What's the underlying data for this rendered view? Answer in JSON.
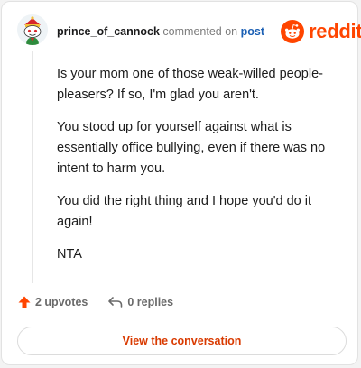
{
  "comment": {
    "username": "prince_of_cannock",
    "action_text": "commented on",
    "target_link": "post",
    "paragraphs": [
      "Is your mom one of those weak-willed people-pleasers? If so, I'm glad you aren't.",
      "You stood up for yourself against what is essentially office bullying, even if there was no intent to harm you.",
      "You did the right thing and I hope you'd do it again!",
      "NTA"
    ]
  },
  "brand": {
    "name": "reddit",
    "color": "#ff4500",
    "icon": "reddit-snoo-icon"
  },
  "actions": {
    "upvotes_label": "2 upvotes",
    "upvote_icon": "upvote-arrow-icon",
    "replies_label": "0 replies",
    "reply_icon": "reply-arrow-icon"
  },
  "footer": {
    "view_button_label": "View the conversation",
    "accent": "#d93a00"
  }
}
